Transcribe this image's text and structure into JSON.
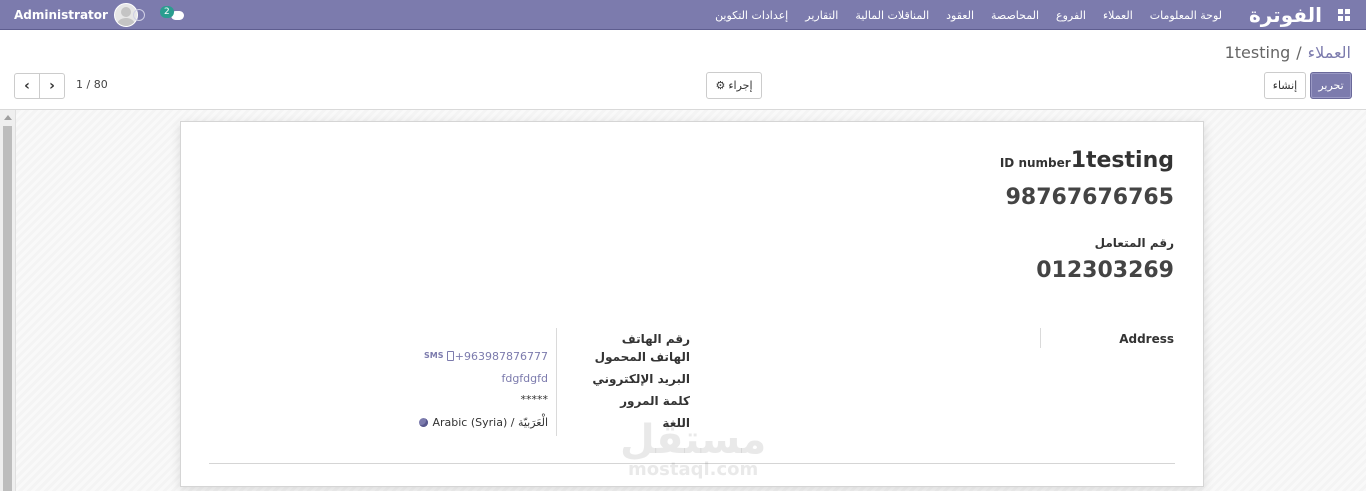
{
  "navbar": {
    "app_title": "الفوترة",
    "menu": [
      "لوحة المعلومات",
      "العملاء",
      "الفروع",
      "المحاصصة",
      "العقود",
      "المناقلات المالية",
      "التقارير",
      "إعدادات التكوين"
    ],
    "user_name": "Administrator",
    "chat_count": "2"
  },
  "breadcrumb": {
    "parent": "العملاء",
    "separator": "/",
    "current": "1testing"
  },
  "buttons": {
    "edit": "تحرير",
    "create": "إنشاء",
    "action": "إجراء"
  },
  "pager": {
    "text": "1 / 80"
  },
  "record": {
    "id_label": "ID number",
    "name": "1testing",
    "id_value": "98767676765",
    "partner_number_label": "رقم المتعامل",
    "partner_number": "012303269",
    "address_label": "Address",
    "fields": [
      {
        "label": "رقم الهاتف",
        "value": ""
      },
      {
        "label": "الهاتف المحمول",
        "value": "+963987876777"
      },
      {
        "label": "البريد الإلكتروني",
        "value": "fdgfdgfd"
      },
      {
        "label": "كلمة المرور",
        "value": "*****"
      },
      {
        "label": "اللغة",
        "value": "Arabic (Syria) / الْعَرَبيّة"
      }
    ],
    "sms_label": "SMS"
  },
  "watermark": {
    "arabic": "مستقل",
    "latin": "mostaql.com"
  },
  "colors": {
    "brand": "#7c7bad",
    "badge": "#2a9d8f"
  }
}
